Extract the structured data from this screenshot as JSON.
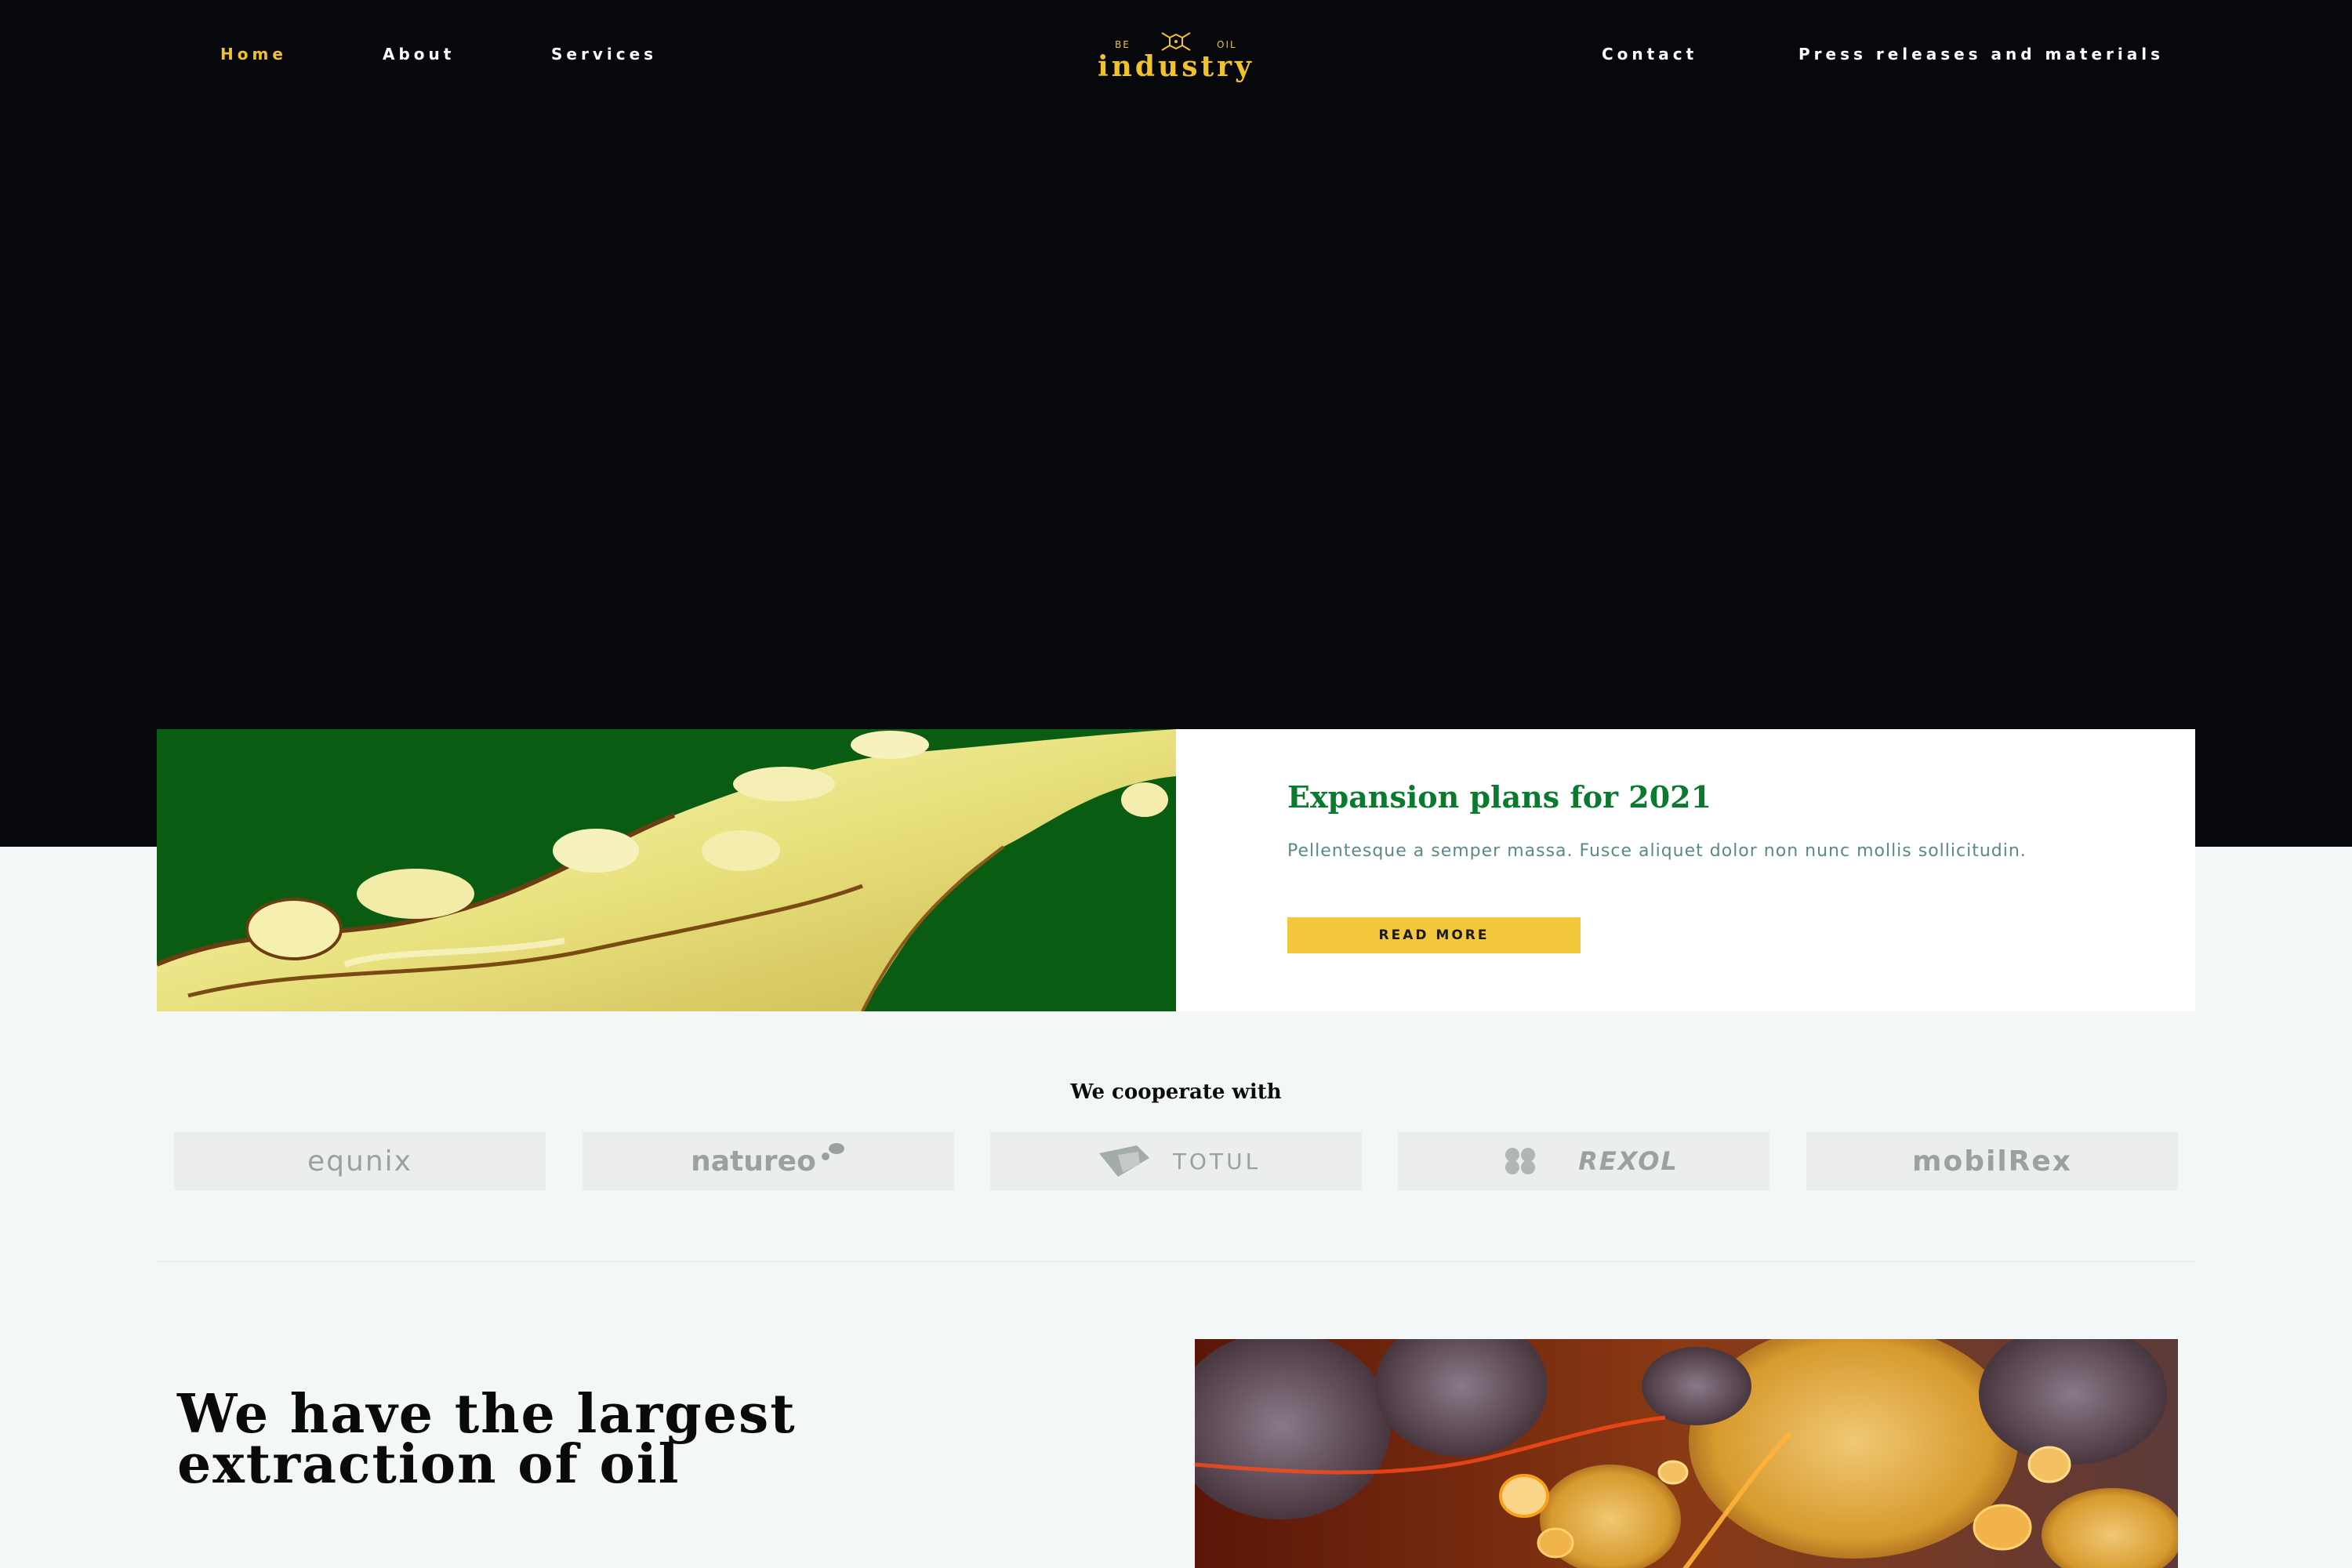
{
  "nav": {
    "items": [
      "Home",
      "About",
      "Services",
      "Contact",
      "Press releases and materials"
    ],
    "active": "Home"
  },
  "logo": {
    "left_small": "BE",
    "right_small": "OIL",
    "word": "industry"
  },
  "feature": {
    "title": "Expansion plans for 2021",
    "text": "Pellentesque a semper massa. Fusce aliquet dolor non nunc mollis sollicitudin.",
    "button_label": "READ MORE"
  },
  "cooperate": {
    "heading": "We cooperate with",
    "partners": [
      "equnix",
      "natureo",
      "TOTUL",
      "REXOL",
      "mobilRex"
    ]
  },
  "about": {
    "heading": "We have the largest extraction of oil"
  },
  "colors": {
    "accent_yellow": "#f2c12e",
    "green": "#0a7a2e",
    "dark": "#07080b",
    "button": "#f4c83c"
  }
}
